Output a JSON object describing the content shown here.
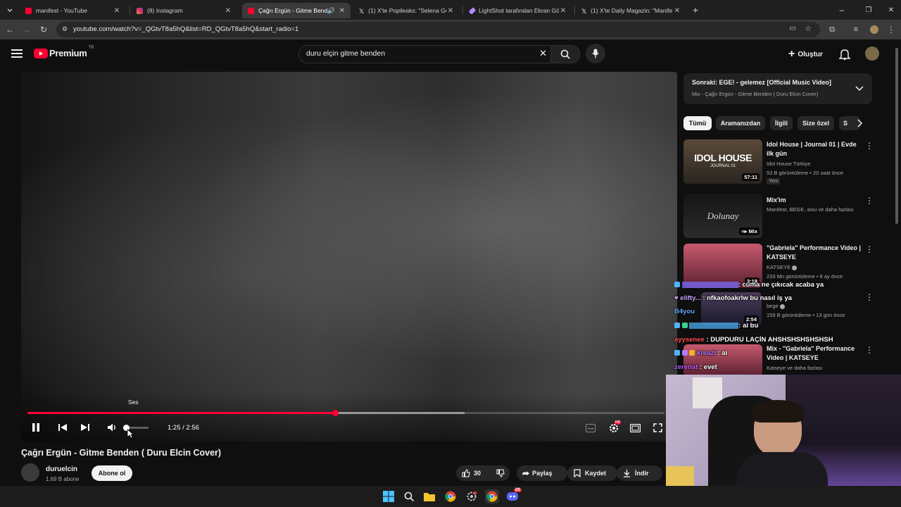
{
  "browser": {
    "tabs": [
      {
        "title": "manifest - YouTube",
        "favicon": "youtube-icon"
      },
      {
        "title": "(8) Instagram",
        "favicon": "instagram-icon"
      },
      {
        "title": "Çağrı Ergün - Gitme Bende",
        "favicon": "youtube-icon",
        "active": true
      },
      {
        "title": "(1) X'te Popileaks: \"Selena Gom",
        "favicon": "x-icon"
      },
      {
        "title": "LightShot tarafından Ekran Gör",
        "favicon": "lightshot-icon"
      },
      {
        "title": "(1) X'te Daily Magazin: \"Manife",
        "favicon": "x-icon"
      }
    ],
    "url": "youtube.com/watch?v=_QGtvT8a5hQ&list=RD_QGtvT8a5hQ&start_radio=1"
  },
  "youtube": {
    "logo_text": "Premium",
    "logo_region": "TR",
    "search_value": "duru elçin gitme benden",
    "create_label": "Oluştur"
  },
  "player": {
    "tooltip": "Ses",
    "time_current": "1:25",
    "time_total": "2:56",
    "progress_fraction": 0.483,
    "buffer_fraction": 0.686,
    "volume_fraction": 0.1
  },
  "video": {
    "title": "Çağrı Ergün - Gitme Benden ( Duru Elcin Cover)",
    "channel": "duruelcin",
    "subscribers": "1,69 B abone",
    "subscribe_label": "Abone ol",
    "likes": "30",
    "share_label": "Paylaş",
    "save_label": "Kaydet",
    "download_label": "İndir"
  },
  "sidebar": {
    "next_title": "Sonraki: EGE! - gelemez [Official Music Video]",
    "next_sub": "Mix - Çağrı Ergün - Gitme Benden ( Duru Elcin Cover)",
    "chips": [
      "Tümü",
      "Aramanızdan",
      "İlgili",
      "Size özel",
      "S"
    ],
    "cards": [
      {
        "title": "Idol House | Journal 01 | Evde ilk gün",
        "channel": "Idol House Türkiye",
        "meta": "53 B görüntüleme • 20 saat önce",
        "badge": "Yeni",
        "duration": "57:11",
        "thumb_text": "IDOL HOUSE",
        "thumb_sub": "JOURNAL 01"
      },
      {
        "title": "Mix'im",
        "channel": "Manifest, BEGE, aisu ve daha fazlası",
        "duration": "Mix",
        "thumb_text": "Dolunay"
      },
      {
        "title": "\"Gabriela\" Performance Video | KATSEYE",
        "channel": "KATSEYE",
        "meta": "233 Mn görüntüleme • 8 ay önce",
        "duration": "3:18"
      },
      {
        "title": "",
        "channel": "bege",
        "meta": "159 B görüntüleme • 13 gün önce",
        "duration": "2:54"
      },
      {
        "title": "Mix - \"Gabriela\" Performance Video | KATSEYE",
        "channel": "Katseye ve daha fazlası"
      }
    ]
  },
  "chat": [
    {
      "user": "",
      "msg": ": cuma ne çıkıcak acaba ya",
      "color": "#7b6cff"
    },
    {
      "user": "elifty...",
      "msg": ": nfkaofoakrlw bu nasıl iş ya",
      "color": "#c9a2ff"
    },
    {
      "user": "B4you",
      "msg": "",
      "color": "#6aa8ff"
    },
    {
      "user": "",
      "msg": ": ai bu",
      "color": "#4fb6ff"
    },
    {
      "user": "ayysenee",
      "msg": ": DUPDURU LAÇİN AHSHSHSHSHSHSH",
      "color": "#ff4f4f"
    },
    {
      "user": "kreazi",
      "msg": ": ai",
      "color": "#b07cff"
    },
    {
      "user": "zerenat",
      "msg": ": evet",
      "color": "#c25dff"
    }
  ],
  "taskbar": {
    "icons": [
      "windows-start-icon",
      "search-icon",
      "file-explorer-icon",
      "chrome-icon",
      "settings-icon",
      "chrome-icon",
      "discord-icon"
    ],
    "discord_badge": "29"
  },
  "colors": {
    "progress": "#ff0033",
    "background": "#0f0f0f",
    "chip_active": "#f1f1f1"
  }
}
